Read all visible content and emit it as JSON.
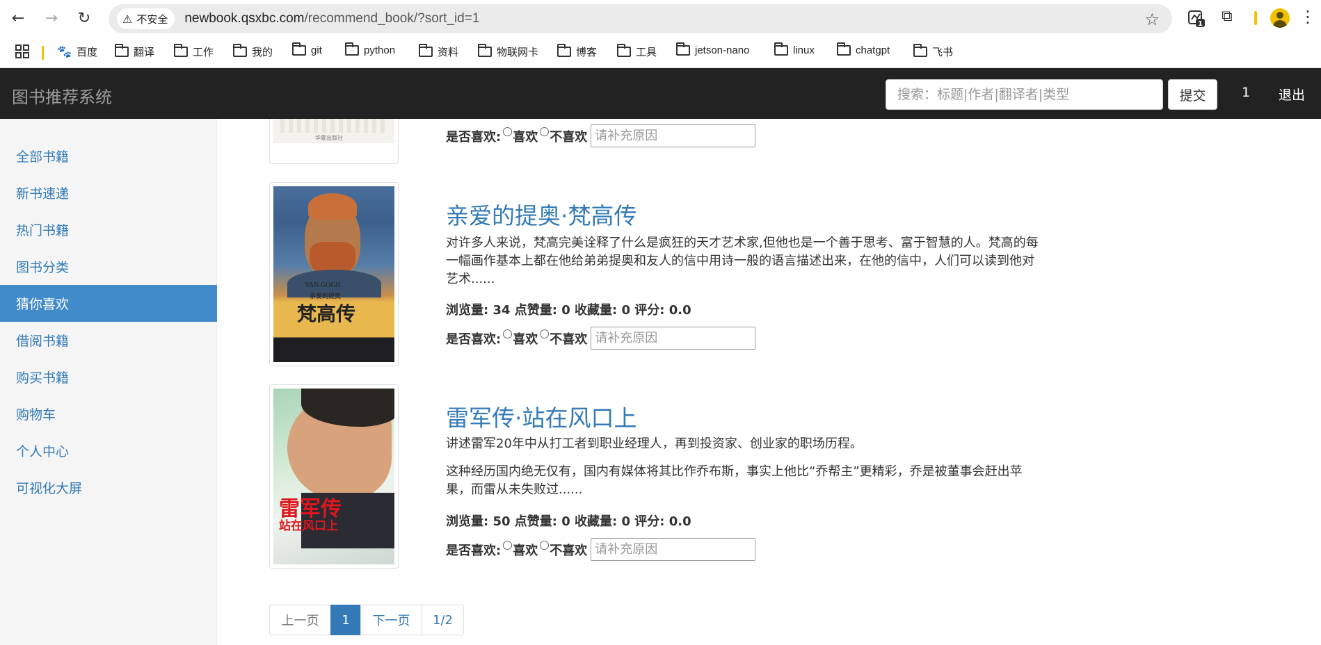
{
  "browser": {
    "security_label": "不安全",
    "url_host": "newbook.qsxbc.com",
    "url_path": "/recommend_book/?sort_id=1",
    "extension_badge": "1",
    "bookmarks": [
      "百度",
      "翻译",
      "工作",
      "我的",
      "git",
      "python",
      "资料",
      "物联网卡",
      "博客",
      "工具",
      "jetson-nano",
      "linux",
      "chatgpt",
      "飞书"
    ]
  },
  "header": {
    "brand": "图书推荐系统",
    "search_placeholder": "搜索：标题|作者|翻译者|类型",
    "submit_label": "提交",
    "user": "1",
    "logout": "退出"
  },
  "sidebar": {
    "items": [
      {
        "label": "全部书籍"
      },
      {
        "label": "新书速递"
      },
      {
        "label": "热门书籍"
      },
      {
        "label": "图书分类"
      },
      {
        "label": "猜你喜欢",
        "active": true
      },
      {
        "label": "借阅书籍"
      },
      {
        "label": "购买书籍"
      },
      {
        "label": "购物车"
      },
      {
        "label": "个人中心"
      },
      {
        "label": "可视化大屏"
      }
    ]
  },
  "labels": {
    "like_question": "是否喜欢:",
    "like": "喜欢",
    "dislike": "不喜欢",
    "reason_placeholder": "请补充原因"
  },
  "books": [
    {
      "title": "",
      "cover_text": "华夏出版社"
    },
    {
      "title": "亲爱的提奥·梵高传",
      "desc": "对许多人来说，梵高完美诠释了什么是疯狂的天才艺术家,但他也是一个善于思考、富于智慧的人。梵高的每一幅画作基本上都在他给弟弟提奥和友人的信中用诗一般的语言描述出来，在他的信中，人们可以读到他对艺术......",
      "stats": "浏览量: 34 点赞量: 0 收藏量: 0 评分: 0.0",
      "cover_title": "梵高传",
      "cover_sub": "VAN GOGH",
      "cover_sub2": "亲爱的提奥"
    },
    {
      "title": "雷军传·站在风口上",
      "desc": "讲述雷军20年中从打工者到职业经理人，再到投资家、创业家的职场历程。",
      "desc2": "这种经历国内绝无仅有，国内有媒体将其比作乔布斯，事实上他比“乔帮主”更精彩，乔是被董事会赶出苹果，而雷从未失败过......",
      "stats": "浏览量: 50 点赞量: 0 收藏量: 0 评分: 0.0",
      "cover_title": "雷军传",
      "cover_sub": "站在风口上"
    }
  ],
  "pagination": {
    "prev": "上一页",
    "current": "1",
    "next": "下一页",
    "info": "1/2"
  }
}
